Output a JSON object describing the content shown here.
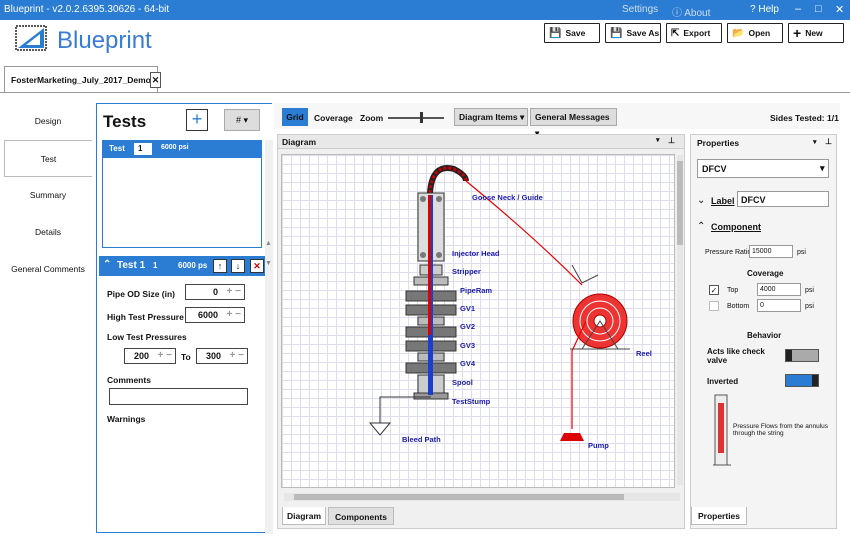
{
  "titlebar": {
    "title": "Blueprint - v2.0.2.6395.30626 - 64-bit",
    "settings": "Settings",
    "about": "About",
    "help": "Help",
    "min": "–",
    "max": "□",
    "close": "✕"
  },
  "app": {
    "name": "Blueprint",
    "brand_color": "#2b7cd3"
  },
  "toolbar": {
    "save": "Save",
    "save_as": "Save As",
    "export": "Export",
    "open": "Open",
    "new": "New"
  },
  "file_tab": {
    "name": "FosterMarketing_July_2017_Demo",
    "close": "✕"
  },
  "nav": {
    "items": [
      "Design",
      "Test",
      "Summary",
      "Details",
      "General Comments"
    ],
    "selected": "Test"
  },
  "tests": {
    "title": "Tests",
    "add": "+",
    "sort": "#",
    "list": [
      {
        "label": "Test",
        "number": "1",
        "pressure": "6000 psi"
      }
    ],
    "detail": {
      "header": "Test 1",
      "number": "1",
      "pressure": "6000 ps",
      "pipe_od_label": "Pipe OD Size (in)",
      "pipe_od_value": "0",
      "high_label": "High Test Pressure",
      "high_value": "6000",
      "low_label": "Low Test Pressures",
      "low_from": "200",
      "to_label": "To",
      "low_to": "300",
      "comments_label": "Comments",
      "comments_value": "",
      "warnings_label": "Warnings"
    }
  },
  "diagram_toolbar": {
    "grid": "Grid",
    "coverage": "Coverage",
    "zoom": "Zoom",
    "zoom_level": 0.6,
    "items": "Diagram Items",
    "messages": "General Messages",
    "sides_tested": "Sides Tested: 1/1"
  },
  "diagram": {
    "title": "Diagram",
    "pin": "📌",
    "labels": [
      "Goose Neck / Guide",
      "Injector Head",
      "Stripper",
      "PipeRam",
      "GV1",
      "GV2",
      "GV3",
      "GV4",
      "Spool",
      "TestStump",
      "Bleed Path",
      "Reel",
      "Pump"
    ],
    "tabs": [
      "Diagram",
      "Components"
    ],
    "selected_tab": "Diagram"
  },
  "properties": {
    "title": "Properties",
    "component": "DFCV",
    "label_section": "Label",
    "label_value": "DFCV",
    "component_section": "Component",
    "pressure_rating_label": "Pressure Rating",
    "pressure_rating": "15000",
    "psi": "psi",
    "coverage_title": "Coverage",
    "top_label": "Top",
    "top_value": "4000",
    "top_checked": true,
    "bottom_label": "Bottom",
    "bottom_value": "0",
    "bottom_checked": false,
    "behavior_title": "Behavior",
    "check_valve_label": "Acts like check valve",
    "check_valve_on": false,
    "inverted_label": "Inverted",
    "inverted_on": true,
    "flow_note": "Pressure Flows from the annulus through the string",
    "tab": "Properties"
  }
}
